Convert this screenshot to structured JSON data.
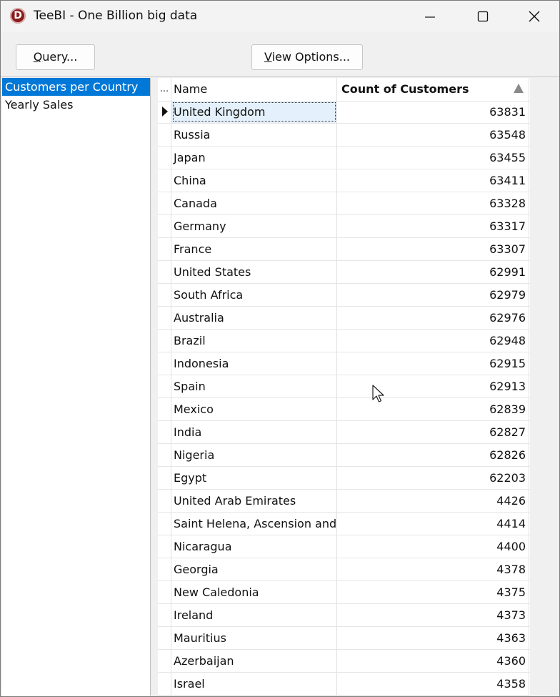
{
  "window": {
    "title": "TeeBI - One Billion big data",
    "app_icon_letter": "D",
    "accent_color": "#0078d7"
  },
  "toolbar": {
    "query_accel": "Q",
    "query_rest": "uery...",
    "view_accel": "V",
    "view_rest": "iew Options..."
  },
  "sidebar": {
    "items": [
      {
        "label": "Customers per Country",
        "selected": true
      },
      {
        "label": "Yearly Sales",
        "selected": false
      }
    ]
  },
  "grid": {
    "indicator_header": "...",
    "columns": [
      "Name",
      "Count of Customers"
    ],
    "sort": {
      "column": "Count of Customers",
      "icon": "sort-ascending-icon"
    },
    "current_row": 0,
    "rows": [
      {
        "name": "United Kingdom",
        "count": "63831"
      },
      {
        "name": "Russia",
        "count": "63548"
      },
      {
        "name": "Japan",
        "count": "63455"
      },
      {
        "name": "China",
        "count": "63411"
      },
      {
        "name": "Canada",
        "count": "63328"
      },
      {
        "name": "Germany",
        "count": "63317"
      },
      {
        "name": "France",
        "count": "63307"
      },
      {
        "name": "United States",
        "count": "62991"
      },
      {
        "name": "South Africa",
        "count": "62979"
      },
      {
        "name": "Australia",
        "count": "62976"
      },
      {
        "name": "Brazil",
        "count": "62948"
      },
      {
        "name": "Indonesia",
        "count": "62915"
      },
      {
        "name": "Spain",
        "count": "62913"
      },
      {
        "name": "Mexico",
        "count": "62839"
      },
      {
        "name": "India",
        "count": "62827"
      },
      {
        "name": "Nigeria",
        "count": "62826"
      },
      {
        "name": "Egypt",
        "count": "62203"
      },
      {
        "name": "United Arab Emirates",
        "count": "4426"
      },
      {
        "name": "Saint Helena, Ascension and Tristan da Cunha",
        "count": "4414"
      },
      {
        "name": "Nicaragua",
        "count": "4400"
      },
      {
        "name": "Georgia",
        "count": "4378"
      },
      {
        "name": "New Caledonia",
        "count": "4375"
      },
      {
        "name": "Ireland",
        "count": "4373"
      },
      {
        "name": "Mauritius",
        "count": "4363"
      },
      {
        "name": "Azerbaijan",
        "count": "4360"
      },
      {
        "name": "Israel",
        "count": "4358"
      }
    ]
  }
}
